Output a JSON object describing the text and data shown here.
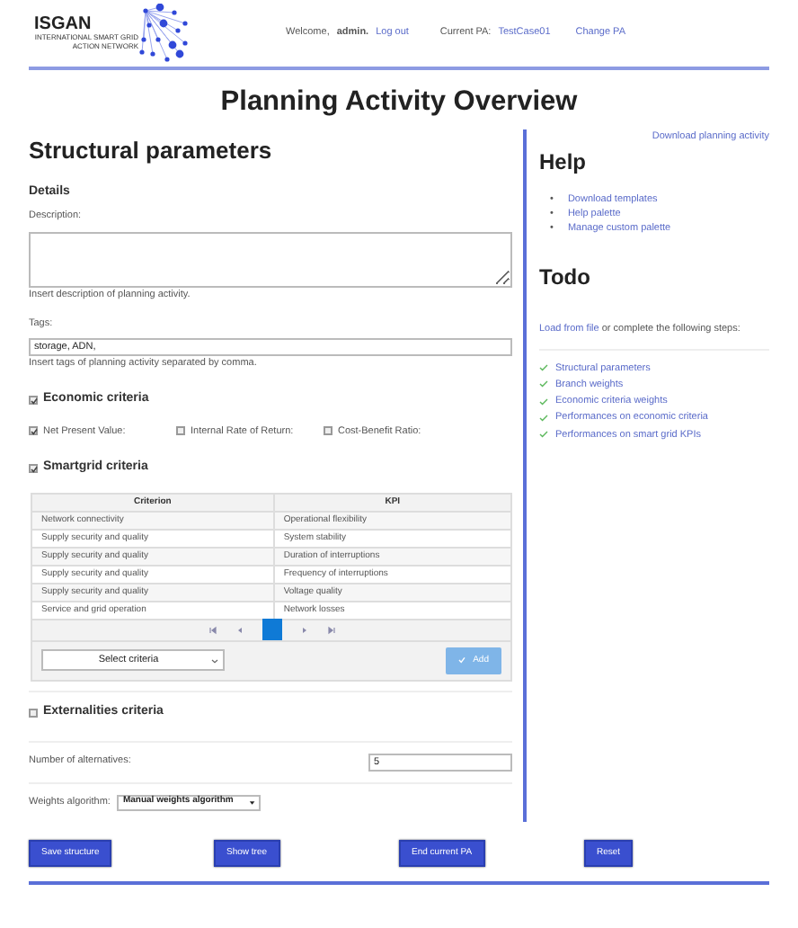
{
  "header": {
    "logo_text": "ISGAN",
    "logo_subtext": "INTERNATIONAL SMART GRID ACTION NETWORK",
    "welcome": "Welcome,",
    "user": "admin.",
    "logout": "Log out",
    "current_pa_label": "Current PA:",
    "current_pa": "TestCase01",
    "change_pa": "Change PA"
  },
  "page_title": "Planning Activity Overview",
  "structural": {
    "title": "Structural parameters",
    "details_title": "Details",
    "description_label": "Description:",
    "description_hint": "Insert description of planning activity.",
    "tags_label": "Tags:",
    "tags_value": "storage, ADN,",
    "tags_hint": "Insert tags of planning activity separated by comma.",
    "economic": {
      "label": "Economic criteria",
      "checked": true,
      "options": [
        {
          "label": "Net Present Value:",
          "checked": true
        },
        {
          "label": "Internal Rate of Return:",
          "checked": false
        },
        {
          "label": "Cost-Benefit Ratio:",
          "checked": false
        }
      ]
    },
    "smartgrid": {
      "label": "Smartgrid criteria",
      "checked": true,
      "columns": [
        "Criterion",
        "KPI"
      ],
      "rows": [
        [
          "Network connectivity",
          "Operational flexibility"
        ],
        [
          "Supply security and quality",
          "System stability"
        ],
        [
          "Supply security and quality",
          "Duration of interruptions"
        ],
        [
          "Supply security and quality",
          "Frequency of interruptions"
        ],
        [
          "Supply security and quality",
          "Voltage quality"
        ],
        [
          "Service and grid operation",
          "Network losses"
        ]
      ],
      "select_placeholder": "Select criteria",
      "add_button": "Add"
    },
    "externalities": {
      "label": "Externalities criteria",
      "checked": false
    },
    "alternatives_label": "Number of alternatives:",
    "alternatives_value": "5",
    "weights_label": "Weights algorithm:",
    "weights_value": "Manual weights algorithm"
  },
  "sidebar": {
    "download": "Download planning activity",
    "help_title": "Help",
    "help_bullet": "•",
    "help_links": [
      "Download templates",
      "Help palette",
      "Manage custom palette"
    ],
    "todo_title": "Todo",
    "todo_intro_link": "Load from file",
    "todo_intro_rest": " or complete the following steps:",
    "todo_items": [
      {
        "label": "Structural parameters",
        "done": true
      },
      {
        "label": "Branch weights",
        "done": true
      },
      {
        "label": "Economic criteria weights",
        "done": true
      },
      {
        "label": "Performances on economic criteria",
        "done": true
      },
      {
        "label": "Performances on smart grid KPIs",
        "done": true
      }
    ]
  },
  "buttons": [
    "Save structure",
    "Show tree",
    "End current PA",
    "Reset"
  ]
}
